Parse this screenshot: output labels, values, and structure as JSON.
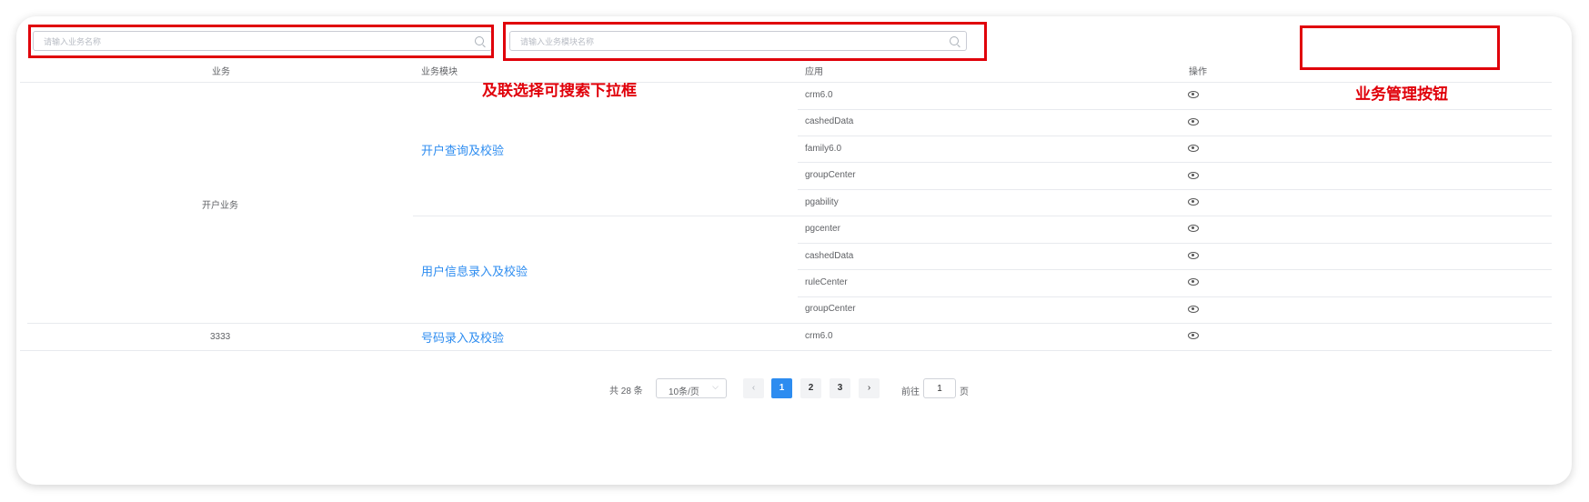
{
  "filters": {
    "business_placeholder": "请输入业务名称",
    "module_placeholder": "请输入业务模块名称"
  },
  "table": {
    "headers": {
      "business": "业务",
      "module": "业务模块",
      "app": "应用",
      "action": "操作"
    },
    "business_groups": [
      {
        "name": "开户业务",
        "modules": [
          {
            "name": "开户查询及校验",
            "apps": [
              "crm6.0",
              "cashedData",
              "family6.0",
              "groupCenter",
              "pgability"
            ]
          },
          {
            "name": "用户信息录入及校验",
            "apps": [
              "pgcenter",
              "cashedData",
              "ruleCenter",
              "groupCenter"
            ]
          }
        ]
      },
      {
        "name": "3333",
        "modules": [
          {
            "name": "号码录入及校验",
            "apps": [
              "crm6.0"
            ]
          }
        ]
      }
    ],
    "action_icon": "eye-icon"
  },
  "annotations": {
    "cascade_select": "及联选择可搜索下拉框",
    "business_buttons": "业务管理按钮"
  },
  "pagination": {
    "total": "共 28 条",
    "page_size": "10条/页",
    "pages": [
      "1",
      "2",
      "3"
    ],
    "current": "1",
    "goto_label": "前往",
    "goto_value": "1",
    "page_suffix": "页"
  },
  "colors": {
    "annotation_red": "#e0000a",
    "link_blue": "#2d8cf0",
    "primary": "#2d8cf0"
  }
}
